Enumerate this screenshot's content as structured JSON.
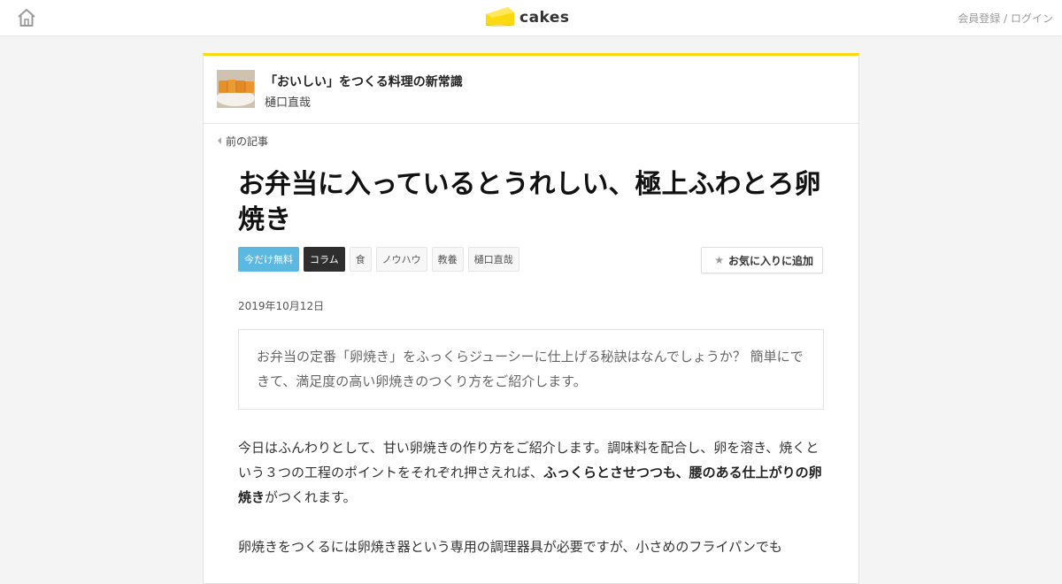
{
  "header": {
    "logo_text": "cakes",
    "auth_register": "会員登録",
    "auth_separator": " / ",
    "auth_login": "ログイン"
  },
  "series": {
    "title": "「おいしい」をつくる料理の新常識",
    "author": "樋口直哉"
  },
  "nav": {
    "prev_label": "前の記事"
  },
  "article": {
    "title": "お弁当に入っているとうれしい、極上ふわとろ卵焼き",
    "tags": [
      "今だけ無料",
      "コラム",
      "食",
      "ノウハウ",
      "教養",
      "樋口直哉"
    ],
    "favorite_label": "お気に入りに追加",
    "date": "2019年10月12日",
    "lead": "お弁当の定番「卵焼き」をふっくらジューシーに仕上げる秘訣はなんでしょうか？ 簡単にできて、満足度の高い卵焼きのつくり方をご紹介します。",
    "p1_before": "今日はふんわりとして、甘い卵焼きの作り方をご紹介します。調味料を配合し、卵を溶き、焼くという３つの工程のポイントをそれぞれ押さえれば、",
    "p1_bold": "ふっくらとさせつつも、腰のある仕上がりの卵焼き",
    "p1_after": "がつくれます。",
    "p2": "卵焼きをつくるには卵焼き器という専用の調理器具が必要ですが、小さめのフライパンでも"
  },
  "colors": {
    "accent_yellow": "#fbd90e",
    "tag_free": "#5bb8e0",
    "tag_column": "#2e2e2e"
  },
  "icons": {
    "home": "home-icon",
    "logo": "cake-logo-icon",
    "prev": "chevron-left-icon",
    "favorite": "star-icon"
  }
}
